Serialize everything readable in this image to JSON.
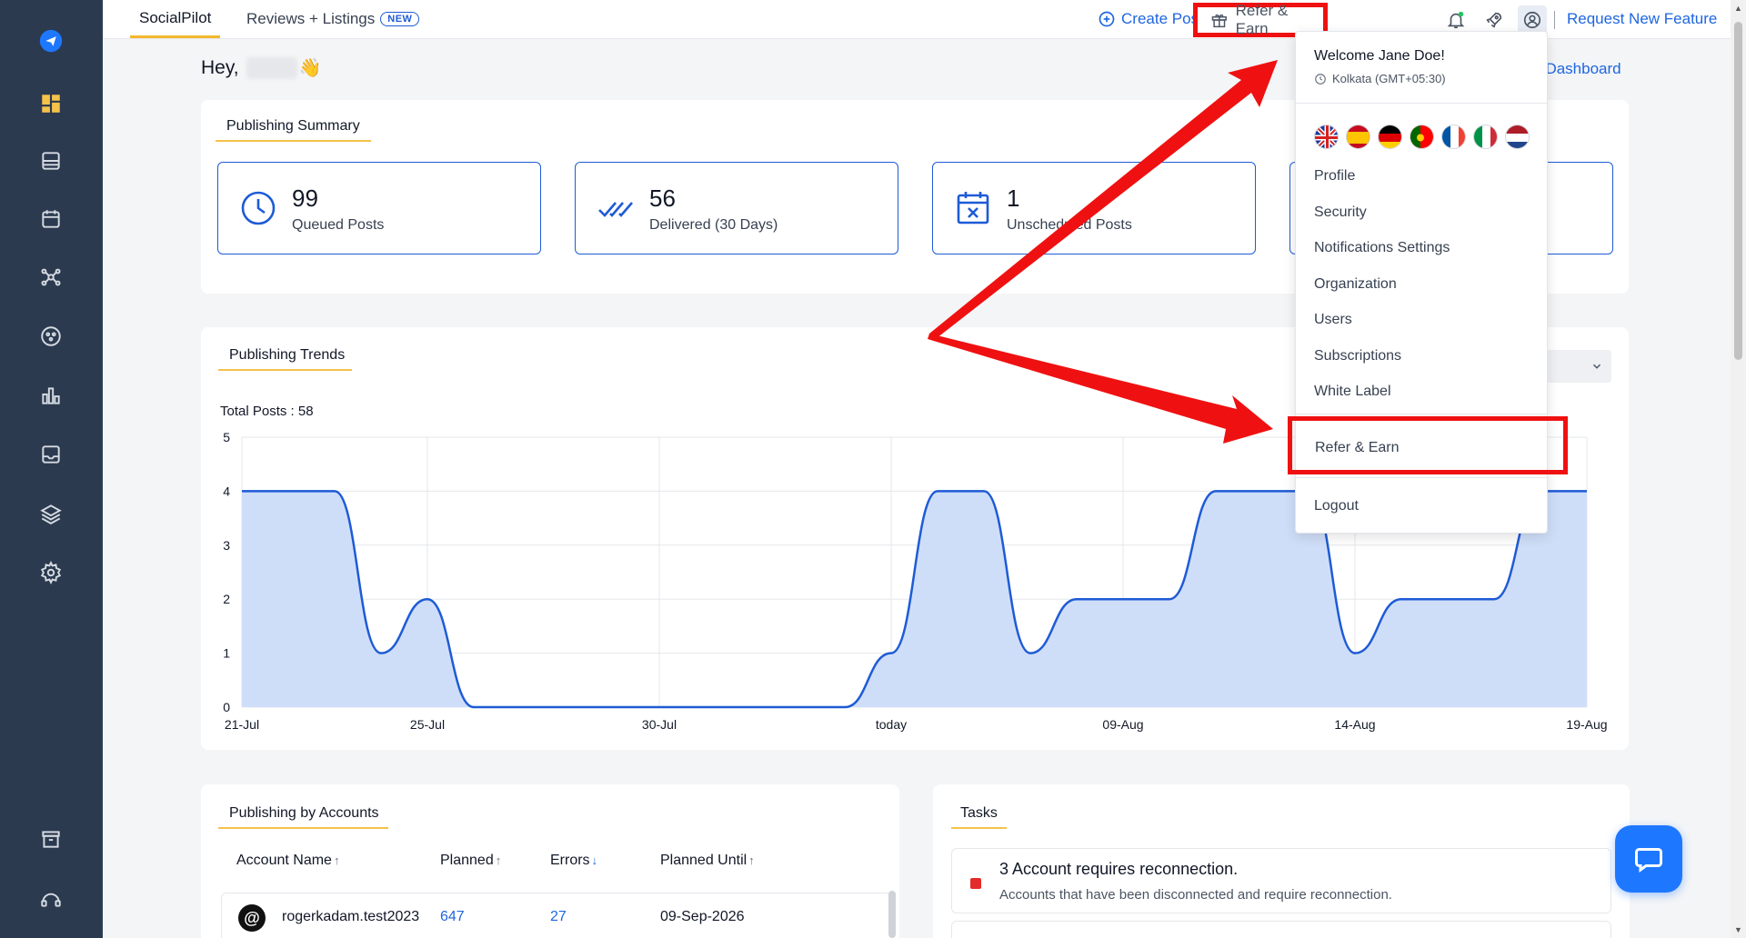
{
  "topbar": {
    "tabs": [
      {
        "label": "SocialPilot"
      },
      {
        "label": "Reviews + Listings",
        "badge": "NEW"
      }
    ],
    "create_post": "Create Post",
    "refer_earn": "Refer & Earn",
    "request_feature": "Request New Feature"
  },
  "greeting": {
    "prefix": "Hey,",
    "emoji": "👋"
  },
  "dashboard_link": "t Dashboard",
  "publishing_summary": {
    "title": "Publishing Summary",
    "stats": [
      {
        "value": "99",
        "label": "Queued Posts",
        "icon": "clock-icon"
      },
      {
        "value": "56",
        "label": "Delivered (30 Days)",
        "icon": "double-check-icon"
      },
      {
        "value": "1",
        "label": "Unscheduled Posts",
        "icon": "calendar-x-icon"
      }
    ]
  },
  "publishing_trends": {
    "title": "Publishing Trends",
    "total_posts": "Total Posts : 58"
  },
  "chart_data": {
    "type": "area",
    "title": "",
    "xlabel": "",
    "ylabel": "",
    "x": [
      "21-Jul",
      "22-Jul",
      "23-Jul",
      "24-Jul",
      "25-Jul",
      "26-Jul",
      "27-Jul",
      "28-Jul",
      "29-Jul",
      "30-Jul",
      "31-Jul",
      "01-Aug",
      "02-Aug",
      "03-Aug",
      "today",
      "05-Aug",
      "06-Aug",
      "07-Aug",
      "08-Aug",
      "09-Aug",
      "10-Aug",
      "11-Aug",
      "12-Aug",
      "13-Aug",
      "14-Aug",
      "15-Aug",
      "16-Aug",
      "17-Aug",
      "18-Aug",
      "19-Aug"
    ],
    "tick_labels": [
      "21-Jul",
      "25-Jul",
      "30-Jul",
      "today",
      "09-Aug",
      "14-Aug",
      "19-Aug"
    ],
    "values": [
      4,
      4,
      4,
      1,
      2,
      0,
      0,
      0,
      0,
      0,
      0,
      0,
      0,
      0,
      1,
      4,
      4,
      1,
      2,
      2,
      2,
      4,
      4,
      4,
      1,
      2,
      2,
      2,
      4,
      4
    ],
    "ylim": [
      0,
      5
    ],
    "yticks": [
      0,
      1,
      2,
      3,
      4,
      5
    ],
    "color": "#1e5bd6",
    "fill": "#cfdef8",
    "grid": true
  },
  "accounts": {
    "title": "Publishing by Accounts",
    "columns": [
      {
        "label": "Account Name",
        "arrow": "↑"
      },
      {
        "label": "Planned",
        "arrow": "↑"
      },
      {
        "label": "Errors",
        "arrow": "↓"
      },
      {
        "label": "Planned Until",
        "arrow": "↑"
      }
    ],
    "rows": [
      {
        "name": "rogerkadam.test2023",
        "planned": "647",
        "errors": "27",
        "until": "09-Sep-2026"
      }
    ]
  },
  "tasks": {
    "title": "Tasks",
    "items": [
      {
        "title": "3 Account requires reconnection.",
        "desc": "Accounts that have been disconnected and require reconnection."
      }
    ]
  },
  "dropdown": {
    "welcome": "Welcome Jane Doe!",
    "timezone": "Kolkata (GMT+05:30)",
    "flags": [
      "uk",
      "es",
      "de",
      "pt",
      "fr",
      "it",
      "nl"
    ],
    "items": [
      "Profile",
      "Security",
      "Notifications Settings",
      "Organization",
      "Users",
      "Subscriptions",
      "White Label"
    ],
    "refer": "Refer & Earn",
    "logout": "Logout"
  },
  "colors": {
    "accent": "#1e66e0",
    "sidebar": "#2b3a4f",
    "highlight": "#ef1111",
    "tab_underline": "#f5b82e"
  }
}
